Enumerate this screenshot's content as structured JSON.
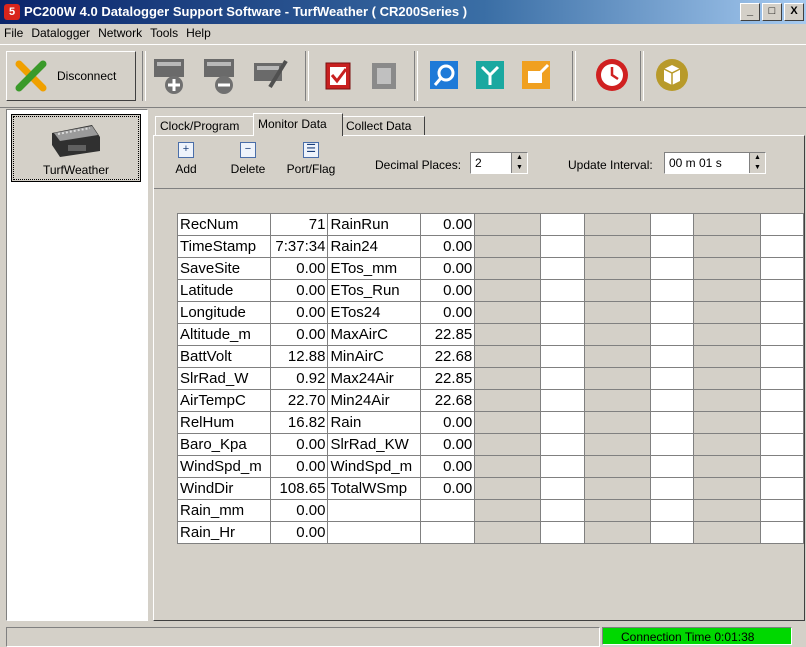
{
  "window": {
    "title": "PC200W 4.0 Datalogger Support Software - TurfWeather ( CR200Series )",
    "min_label": "_",
    "max_label": "□",
    "close_label": "X"
  },
  "menu": [
    "File",
    "Datalogger",
    "Network",
    "Tools",
    "Help"
  ],
  "toolbar": {
    "disconnect_label": "Disconnect",
    "icons": [
      "add-station-icon",
      "delete-station-icon",
      "edit-station-icon",
      "check-icon",
      "copy-icon",
      "search-icon",
      "split-view-icon",
      "edit-file-icon",
      "clock-icon",
      "3d-box-icon"
    ]
  },
  "station": {
    "name": "TurfWeather"
  },
  "tabs": [
    "Clock/Program",
    "Monitor Data",
    "Collect Data"
  ],
  "monitor": {
    "add_label": "Add",
    "delete_label": "Delete",
    "portflag_label": "Port/Flag",
    "decimal_label": "Decimal Places:",
    "decimal_value": "2",
    "interval_label": "Update Interval:",
    "interval_value": "00 m 01 s"
  },
  "grid": {
    "col1": [
      {
        "name": "RecNum",
        "value": "71"
      },
      {
        "name": "TimeStamp",
        "value": "7:37:34"
      },
      {
        "name": "SaveSite",
        "value": "0.00"
      },
      {
        "name": "Latitude",
        "value": "0.00"
      },
      {
        "name": "Longitude",
        "value": "0.00"
      },
      {
        "name": "Altitude_m",
        "value": "0.00"
      },
      {
        "name": "BattVolt",
        "value": "12.88"
      },
      {
        "name": "SlrRad_W",
        "value": "0.92"
      },
      {
        "name": "AirTempC",
        "value": "22.70"
      },
      {
        "name": "RelHum",
        "value": "16.82"
      },
      {
        "name": "Baro_Kpa",
        "value": "0.00"
      },
      {
        "name": "WindSpd_m",
        "value": "0.00"
      },
      {
        "name": "WindDir",
        "value": "108.65"
      },
      {
        "name": "Rain_mm",
        "value": "0.00"
      },
      {
        "name": "Rain_Hr",
        "value": "0.00"
      }
    ],
    "col2": [
      {
        "name": "RainRun",
        "value": "0.00"
      },
      {
        "name": "Rain24",
        "value": "0.00"
      },
      {
        "name": "ETos_mm",
        "value": "0.00"
      },
      {
        "name": "ETos_Run",
        "value": "0.00"
      },
      {
        "name": "ETos24",
        "value": "0.00"
      },
      {
        "name": "MaxAirC",
        "value": "22.85"
      },
      {
        "name": "MinAirC",
        "value": "22.68"
      },
      {
        "name": "Max24Air",
        "value": "22.85"
      },
      {
        "name": "Min24Air",
        "value": "22.68"
      },
      {
        "name": "Rain",
        "value": "0.00"
      },
      {
        "name": "SlrRad_KW",
        "value": "0.00"
      },
      {
        "name": "WindSpd_m",
        "value": "0.00"
      },
      {
        "name": "TotalWSmp",
        "value": "0.00"
      },
      {
        "name": "",
        "value": ""
      },
      {
        "name": "",
        "value": ""
      }
    ]
  },
  "status": {
    "connection": "Connection Time 0:01:38"
  }
}
